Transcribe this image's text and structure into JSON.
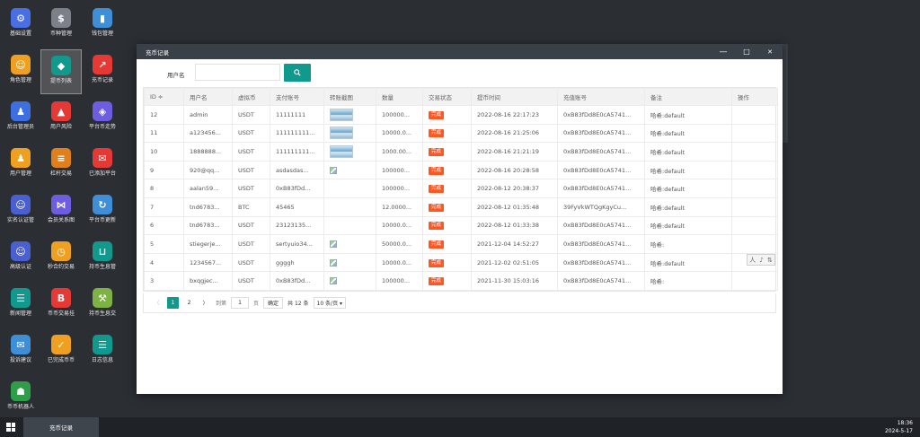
{
  "desktop": {
    "icons": [
      {
        "label": "基础设置",
        "icon": "gear-icon",
        "color": "#4a6fe3",
        "glyph": "⚙"
      },
      {
        "label": "币种管理",
        "icon": "dollar-icon",
        "color": "#7b8089",
        "glyph": "$"
      },
      {
        "label": "钱包管理",
        "icon": "wallet-icon",
        "color": "#3e8fd8",
        "glyph": "▮"
      },
      {
        "label": "角色管理",
        "icon": "role-icon",
        "color": "#f0a020",
        "glyph": "☺"
      },
      {
        "label": "提币列表",
        "icon": "coin-list-icon",
        "color": "#11998e",
        "glyph": "◆"
      },
      {
        "label": "充币记录",
        "icon": "deposit-record-icon",
        "color": "#e53935",
        "glyph": "↗"
      },
      {
        "label": "后台管理员",
        "icon": "admin-icon",
        "color": "#3d6fe0",
        "glyph": "♟"
      },
      {
        "label": "用户风险",
        "icon": "alarm-icon",
        "color": "#e53935",
        "glyph": "▲"
      },
      {
        "label": "平台币走势",
        "icon": "layers-icon",
        "color": "#6d5de0",
        "glyph": "◈"
      },
      {
        "label": "用户管理",
        "icon": "user-icon",
        "color": "#f0a020",
        "glyph": "♟"
      },
      {
        "label": "杠杆交易",
        "icon": "stack-icon",
        "color": "#e0801c",
        "glyph": "≡"
      },
      {
        "label": "已添加平台",
        "icon": "platform-icon",
        "color": "#e53935",
        "glyph": "✉"
      },
      {
        "label": "实名认证管",
        "icon": "verify-icon",
        "color": "#4a5fd0",
        "glyph": "☺"
      },
      {
        "label": "会员关系图",
        "icon": "share-icon",
        "color": "#6d5de0",
        "glyph": "⋈"
      },
      {
        "label": "平台币更新",
        "icon": "cloud-refresh-icon",
        "color": "#3e8fd8",
        "glyph": "↻"
      },
      {
        "label": "高级认证",
        "icon": "advanced-verify-icon",
        "color": "#4a5fd0",
        "glyph": "☺"
      },
      {
        "label": "秒合约交易",
        "icon": "stopwatch-icon",
        "color": "#f0a020",
        "glyph": "◷"
      },
      {
        "label": "持币生息管",
        "icon": "unlock-icon",
        "color": "#11998e",
        "glyph": "⊔"
      },
      {
        "label": "新闻管理",
        "icon": "news-icon",
        "color": "#11998e",
        "glyph": "☰"
      },
      {
        "label": "币币交易挂",
        "icon": "trade-icon",
        "color": "#e53935",
        "glyph": "B"
      },
      {
        "label": "持币生息交",
        "icon": "hammer-icon",
        "color": "#7cb342",
        "glyph": "⚒"
      },
      {
        "label": "投诉建议",
        "icon": "feedback-icon",
        "color": "#3e8fd8",
        "glyph": "✉"
      },
      {
        "label": "已完成币币",
        "icon": "check-icon",
        "color": "#f0a020",
        "glyph": "✓"
      },
      {
        "label": "日志信息",
        "icon": "log-icon",
        "color": "#11998e",
        "glyph": "☰"
      },
      {
        "label": "币币机器人",
        "icon": "robot-icon",
        "color": "#2e9e4a",
        "glyph": "☗"
      }
    ]
  },
  "window": {
    "title": "充币记录",
    "controls": {
      "minimize": "—",
      "maximize": "□",
      "close": "✕"
    }
  },
  "search": {
    "label": "用户名",
    "placeholder": "",
    "button_icon": "search-icon",
    "button_glyph": "⚲"
  },
  "table": {
    "headers": [
      "ID ≑",
      "用户名",
      "虚拟币",
      "支付账号",
      "转账截图",
      "数量",
      "交易状态",
      "提币时间",
      "充值账号",
      "备注",
      "操作"
    ],
    "rows": [
      {
        "id": "12",
        "user": "admin",
        "coin": "USDT",
        "pay": "11111111",
        "shot": "thumb",
        "qty": "100000...",
        "status": "完成",
        "time": "2022-08-16 22:17:23",
        "acct": "0xB83fDd8E0cA5741...",
        "note": "哈希:default"
      },
      {
        "id": "11",
        "user": "a123456...",
        "coin": "USDT",
        "pay": "111111111...",
        "shot": "thumb",
        "qty": "10000.0...",
        "status": "完成",
        "time": "2022-08-16 21:25:06",
        "acct": "0xB83fDd8E0cA5741...",
        "note": "哈希:default"
      },
      {
        "id": "10",
        "user": "1888888...",
        "coin": "USDT",
        "pay": "111111111...",
        "shot": "thumb",
        "qty": "1000.00...",
        "status": "完成",
        "time": "2022-08-16 21:21:19",
        "acct": "0xB83fDd8E0cA5741...",
        "note": "哈希:default"
      },
      {
        "id": "9",
        "user": "920@qq...",
        "coin": "USDT",
        "pay": "asdasdas...",
        "shot": "broken",
        "qty": "100000...",
        "status": "完成",
        "time": "2022-08-16 20:28:58",
        "acct": "0xB83fDd8E0cA5741...",
        "note": "哈希:default"
      },
      {
        "id": "8",
        "user": "aalan59...",
        "coin": "USDT",
        "pay": "0xB83fDd...",
        "shot": "",
        "qty": "100000...",
        "status": "完成",
        "time": "2022-08-12 20:38:37",
        "acct": "0xB83fDd8E0cA5741...",
        "note": "哈希:default"
      },
      {
        "id": "7",
        "user": "tnd6783...",
        "coin": "BTC",
        "pay": "45465",
        "shot": "",
        "qty": "12.0000...",
        "status": "完成",
        "time": "2022-08-12 01:35:48",
        "acct": "39FyVkWTQgKgyCu...",
        "note": "哈希:default"
      },
      {
        "id": "6",
        "user": "tnd6783...",
        "coin": "USDT",
        "pay": "23123135...",
        "shot": "",
        "qty": "10000.0...",
        "status": "完成",
        "time": "2022-08-12 01:33:38",
        "acct": "0xB83fDd8E0cA5741...",
        "note": "哈希:default"
      },
      {
        "id": "5",
        "user": "stiegerje...",
        "coin": "USDT",
        "pay": "sertyuio34...",
        "shot": "broken",
        "qty": "50000.0...",
        "status": "完成",
        "time": "2021-12-04 14:52:27",
        "acct": "0xB83fDd8E0cA5741...",
        "note": "哈希:"
      },
      {
        "id": "4",
        "user": "1234567...",
        "coin": "USDT",
        "pay": "ggggh",
        "shot": "broken",
        "qty": "10000.0...",
        "status": "完成",
        "time": "2021-12-02 02:51:05",
        "acct": "0xB83fDd8E0cA5741...",
        "note": "哈希:default"
      },
      {
        "id": "3",
        "user": "bxqgjec...",
        "coin": "USDT",
        "pay": "0xB83fDd...",
        "shot": "broken",
        "qty": "100000...",
        "status": "完成",
        "time": "2021-11-30 15:03:16",
        "acct": "0xB83fDd8E0cA5741...",
        "note": "哈希:"
      }
    ]
  },
  "pager": {
    "prev": "〈",
    "page1": "1",
    "page2": "2",
    "next": "〉",
    "goto_label": "到第",
    "goto_value": "1",
    "page_unit": "页",
    "confirm": "确定",
    "total": "共 12 条",
    "per_page": "10 条/页 ▾"
  },
  "row_tools": [
    "人",
    "♪",
    "⇅"
  ],
  "taskbar": {
    "task": "充币记录",
    "time": "18:36",
    "date": "2024-5-17"
  }
}
